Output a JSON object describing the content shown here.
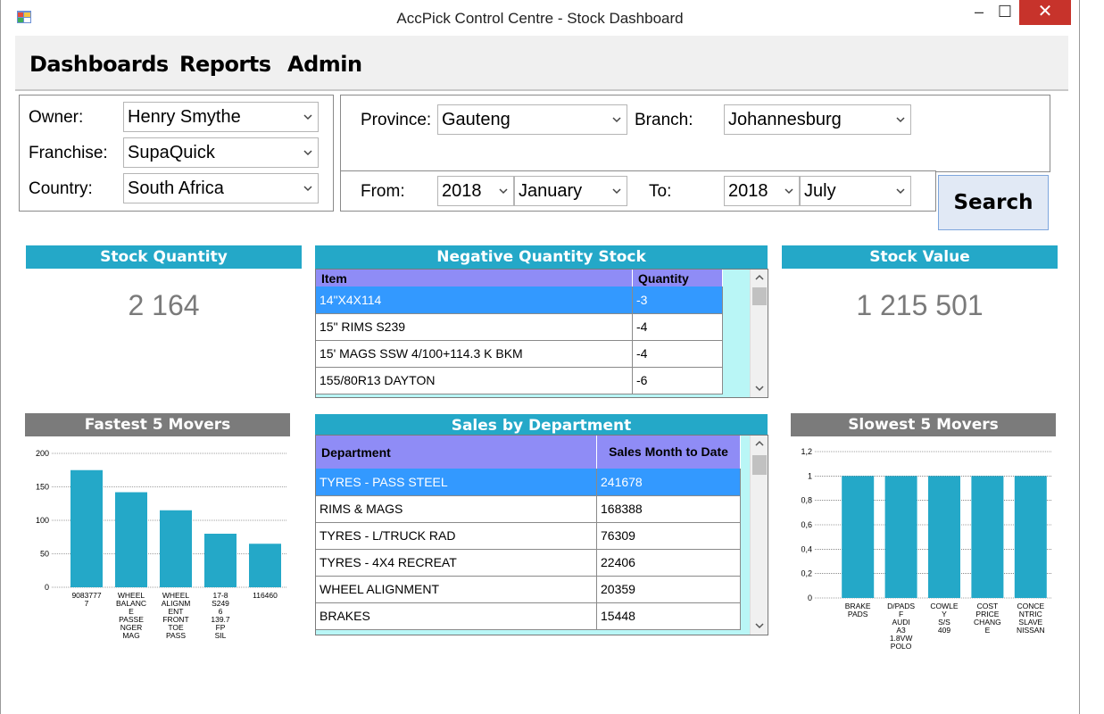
{
  "window": {
    "title": "AccPick Control Centre - Stock Dashboard",
    "minimize_glyph": "–",
    "maximize_glyph": "☐",
    "close_glyph": "✕"
  },
  "menu": {
    "dashboards": "Dashboards",
    "reports": "Reports",
    "admin": "Admin"
  },
  "filters": {
    "owner_label": "Owner:",
    "owner_value": "Henry Smythe",
    "franchise_label": "Franchise:",
    "franchise_value": "SupaQuick",
    "country_label": "Country:",
    "country_value": "South Africa",
    "province_label": "Province:",
    "province_value": "Gauteng",
    "branch_label": "Branch:",
    "branch_value": "Johannesburg",
    "from_label": "From:",
    "from_year": "2018",
    "from_month": "January",
    "to_label": "To:",
    "to_year": "2018",
    "to_month": "July",
    "search_label": "Search"
  },
  "stock_quantity": {
    "title": "Stock Quantity",
    "value": "2 164"
  },
  "stock_value": {
    "title": "Stock Value",
    "value": "1 215 501"
  },
  "negative_stock": {
    "title": "Negative Quantity Stock",
    "col_item": "Item",
    "col_qty": "Quantity",
    "rows": [
      {
        "item": "14\"X4X114",
        "qty": "-3"
      },
      {
        "item": "15\" RIMS S239",
        "qty": "-4"
      },
      {
        "item": "15' MAGS SSW 4/100+114.3 K BKM",
        "qty": "-4"
      },
      {
        "item": "155/80R13 DAYTON",
        "qty": "-6"
      }
    ]
  },
  "sales_by_dept": {
    "title": "Sales by Department",
    "col_dept": "Department",
    "col_sales": "Sales Month to Date",
    "rows": [
      {
        "dept": "TYRES - PASS STEEL",
        "sales": "241678"
      },
      {
        "dept": "RIMS & MAGS",
        "sales": "168388"
      },
      {
        "dept": "TYRES - L/TRUCK RAD",
        "sales": "76309"
      },
      {
        "dept": "TYRES - 4X4 RECREAT",
        "sales": "22406"
      },
      {
        "dept": "WHEEL ALIGNMENT",
        "sales": "20359"
      },
      {
        "dept": "BRAKES",
        "sales": "15448"
      }
    ]
  },
  "fastest_title": "Fastest 5 Movers",
  "slowest_title": "Slowest 5 Movers",
  "chart_data": [
    {
      "type": "bar",
      "categories": [
        "9083777 7",
        "WHEEL BALANC E PASSE NGER MAG",
        "WHEEL ALIGNM ENT FRONT TOE PASS",
        "17-8 S249 6 139.7 FP SIL",
        "116460"
      ],
      "values": [
        175,
        142,
        115,
        80,
        65
      ],
      "ylim": [
        0,
        200
      ],
      "yticks": [
        "0",
        "50",
        "100",
        "150",
        "200"
      ],
      "color": "#24a8c8"
    },
    {
      "type": "bar",
      "categories": [
        "BRAKE PADS",
        "D/PADS F AUDI A3 1.8VW POLO",
        "COWLE Y S/S 409",
        "COST PRICE CHANG E",
        "CONCE NTRIC SLAVE NISSAN"
      ],
      "values": [
        1,
        1,
        1,
        1,
        1
      ],
      "ylim": [
        0,
        1.2
      ],
      "yticks": [
        "0",
        "0,2",
        "0,4",
        "0,6",
        "0,8",
        "1",
        "1,2"
      ],
      "color": "#24a8c8"
    }
  ]
}
